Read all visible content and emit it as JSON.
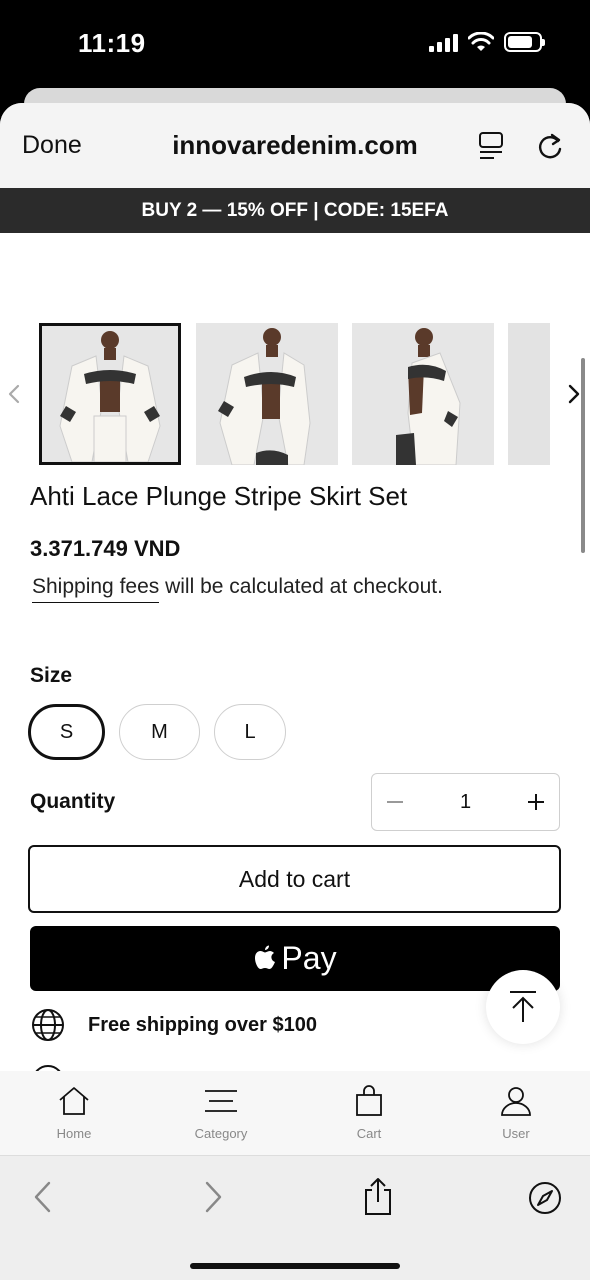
{
  "status": {
    "time": "11:19"
  },
  "browser": {
    "done_label": "Done",
    "url": "innovaredenim.com"
  },
  "promo": {
    "text": "BUY 2 — 15% OFF | CODE: 15EFA"
  },
  "product": {
    "title": "Ahti Lace Plunge Stripe Skirt Set",
    "price": "3.371.749 VND",
    "shipping_link": "Shipping fees",
    "shipping_rest": " will be calculated at checkout.",
    "gallery_count": 4,
    "active_image_index": 0
  },
  "size": {
    "label": "Size",
    "options": [
      "S",
      "M",
      "L"
    ],
    "selected": "S"
  },
  "quantity": {
    "label": "Quantity",
    "value": "1"
  },
  "buttons": {
    "add_to_cart": "Add to cart",
    "apple_pay": "Pay"
  },
  "perks": {
    "free_shipping": "Free shipping over $100"
  },
  "nav": [
    {
      "label": "Home",
      "icon": "home-icon"
    },
    {
      "label": "Category",
      "icon": "menu-icon"
    },
    {
      "label": "Cart",
      "icon": "bag-icon"
    },
    {
      "label": "User",
      "icon": "user-icon"
    }
  ],
  "toolbar": [
    "back-icon",
    "forward-icon",
    "share-icon",
    "compass-icon"
  ]
}
